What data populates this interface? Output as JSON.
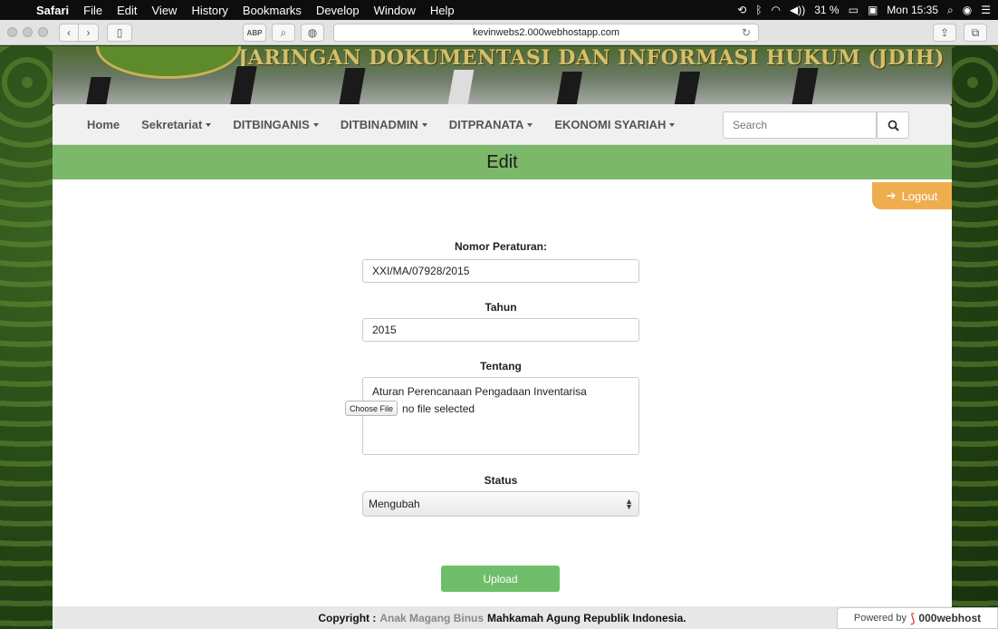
{
  "menubar": {
    "app_name": "Safari",
    "items": [
      "File",
      "Edit",
      "View",
      "History",
      "Bookmarks",
      "Develop",
      "Window",
      "Help"
    ],
    "battery": "31 %",
    "clock": "Mon 15:35"
  },
  "browser": {
    "url": "kevinwebs2.000webhostapp.com"
  },
  "banner": {
    "title": "JARINGAN DOKUMENTASI DAN INFORMASI HUKUM (JDIH)"
  },
  "nav": {
    "items": [
      {
        "label": "Home",
        "dropdown": false
      },
      {
        "label": "Sekretariat",
        "dropdown": true
      },
      {
        "label": "DITBINGANIS",
        "dropdown": true
      },
      {
        "label": "DITBINADMIN",
        "dropdown": true
      },
      {
        "label": "DITPRANATA",
        "dropdown": true
      },
      {
        "label": "EKONOMI SYARIAH",
        "dropdown": true
      }
    ],
    "search_placeholder": "Search"
  },
  "page": {
    "heading": "Edit",
    "logout_label": "Logout"
  },
  "form": {
    "nomor_label": "Nomor Peraturan:",
    "nomor_value": "XXI/MA/07928/2015",
    "tahun_label": "Tahun",
    "tahun_value": "2015",
    "tentang_label": "Tentang",
    "tentang_value": "Aturan Perencanaan Pengadaan Inventarisa",
    "status_label": "Status",
    "status_value": "Mengubah",
    "file_button": "Choose File",
    "file_status": "no file selected",
    "upload_label": "Upload"
  },
  "footer": {
    "prefix": "Copyright :",
    "link_text": "Anak Magang Binus",
    "suffix": "Mahkamah Agung Republik Indonesia.",
    "powered_by": "Powered by",
    "powered_brand": "000webhost"
  },
  "colors": {
    "nav_bar": "#f0f0f0",
    "edit_bar": "#7cb869",
    "logout": "#f0ad4e",
    "upload": "#6fbf6a"
  }
}
